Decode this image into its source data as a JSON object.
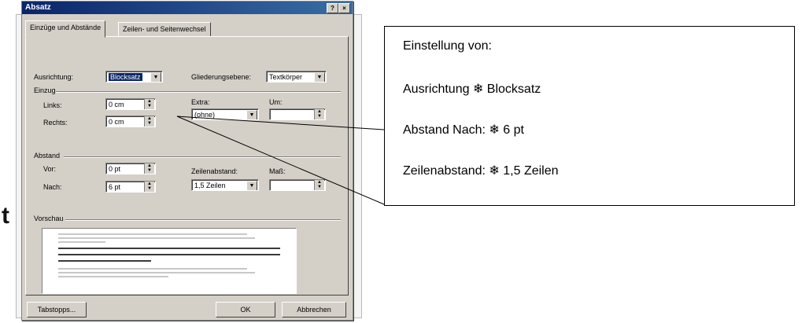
{
  "dialog": {
    "title": "Absatz",
    "help_label": "?",
    "close_label": "×",
    "tabs": [
      {
        "label": "Einzüge und Abstände"
      },
      {
        "label": "Zeilen- und Seitenwechsel"
      }
    ],
    "ausrichtung": {
      "label": "Ausrichtung:",
      "value": "Blocksatz"
    },
    "gliederungsebene": {
      "label": "Gliederungsebene:",
      "value": "Textkörper"
    },
    "einzug": {
      "group_label": "Einzug",
      "links": {
        "label": "Links:",
        "value": "0 cm"
      },
      "rechts": {
        "label": "Rechts:",
        "value": "0 cm"
      },
      "extra": {
        "label": "Extra:",
        "value": "(ohne)"
      },
      "um": {
        "label": "Um:",
        "value": ""
      }
    },
    "abstand": {
      "group_label": "Abstand",
      "vor": {
        "label": "Vor:",
        "value": "0 pt"
      },
      "nach": {
        "label": "Nach:",
        "value": "6 pt"
      },
      "zeilenabstand": {
        "label": "Zeilenabstand:",
        "value": "1,5 Zeilen"
      },
      "mass": {
        "label": "Maß:",
        "value": ""
      }
    },
    "vorschau_label": "Vorschau",
    "buttons": {
      "tabstopps": "Tabstopps...",
      "ok": "OK",
      "abbrechen": "Abbrechen"
    }
  },
  "callout": {
    "heading": "Einstellung von:",
    "line1": "Ausrichtung ❄ Blocksatz",
    "line2": "Abstand Nach: ❄ 6 pt",
    "line3": "Zeilenabstand: ❄ 1,5 Zeilen"
  },
  "background": {
    "fragment_letter": "t"
  },
  "colors": {
    "titlebar": "#0a246a",
    "face": "#d4d0c8",
    "selection": "#0a246a"
  }
}
